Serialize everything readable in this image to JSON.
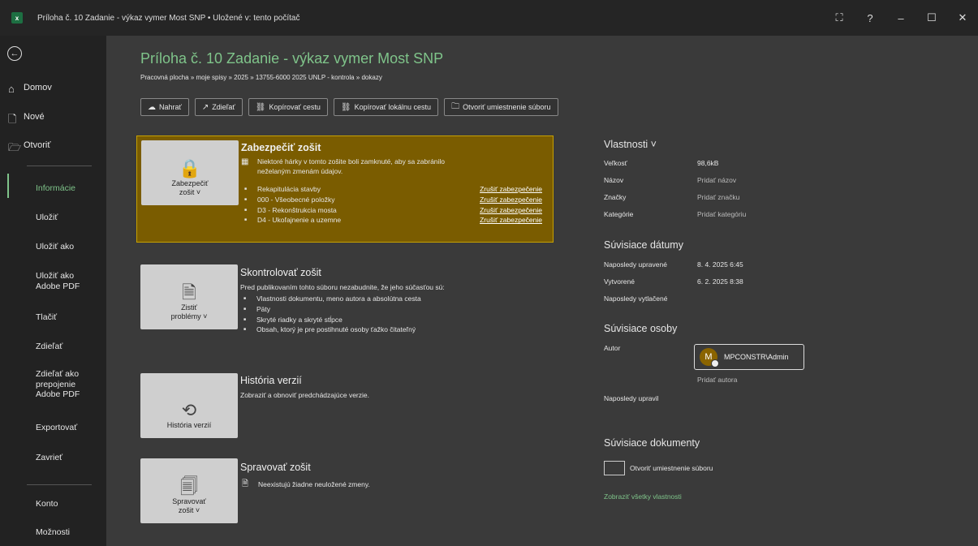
{
  "window": {
    "title": "Príloha č. 10 Zadanie - výkaz vymer Most SNP  •  Uložené v: tento počítač",
    "excel_glyph": "x",
    "ctrl_account": "⛶",
    "ctrl_help": "?",
    "ctrl_minimize": "–",
    "ctrl_maximize": "☐",
    "ctrl_close": "✕"
  },
  "sidebar": {
    "back_glyph": "←",
    "top": [
      {
        "label": "Domov",
        "icon": "home-icon"
      },
      {
        "label": "Nové",
        "icon": "new-document-icon"
      },
      {
        "label": "Otvoriť",
        "icon": "folder-open-icon"
      }
    ],
    "items": [
      {
        "label": "Informácie",
        "active": true
      },
      {
        "label": "Uložiť"
      },
      {
        "label": "Uložiť ako"
      },
      {
        "label": "Uložiť ako\nAdobe PDF"
      },
      {
        "label": "Tlačiť"
      },
      {
        "label": "Zdieľať"
      },
      {
        "label": "Zdieľať ako\nprepojenie\nAdobe PDF"
      },
      {
        "label": "Exportovať"
      },
      {
        "label": "Zavrieť"
      }
    ],
    "bottom": [
      {
        "label": "Konto"
      },
      {
        "label": "Možnosti"
      }
    ]
  },
  "header": {
    "title": "Príloha č. 10 Zadanie - výkaz vymer Most SNP",
    "breadcrumb": "Pracovná plocha » moje spisy » 2025 » 13755-6000 2025 UNLP - kontrola » dokazy"
  },
  "toolbar": [
    {
      "label": "Nahrať",
      "icon": "upload-icon"
    },
    {
      "label": "Zdieľať",
      "icon": "share-icon"
    },
    {
      "label": "Kopírovať cestu",
      "icon": "link-icon"
    },
    {
      "label": "Kopírovať lokálnu cestu",
      "icon": "link-icon"
    },
    {
      "label": "Otvoriť umiestnenie súboru",
      "icon": "folder-icon"
    }
  ],
  "protect": {
    "button": "Zabezpečiť\nzošit ˅",
    "title": "Zabezpečiť zošit",
    "desc": "Niektoré hárky v tomto zošite boli zamknuté, aby sa zabránilo\nneželaným zmenám údajov.",
    "sheets": [
      {
        "name": "Rekapitulácia stavby",
        "action": "Zrušiť zabezpečenie"
      },
      {
        "name": "000 - Všeobecné položky",
        "action": "Zrušiť zabezpečenie"
      },
      {
        "name": "D3 - Rekonštrukcia mosta",
        "action": "Zrušiť zabezpečenie"
      },
      {
        "name": "D4 - Ukoľajnenie a uzemne",
        "action": "Zrušiť zabezpečenie"
      }
    ]
  },
  "inspect": {
    "button": "Zistiť\nproblémy ˅",
    "title": "Skontrolovať zošit",
    "desc": "Pred publikovaním tohto súboru nezabudnite, že jeho súčasťou sú:",
    "items": [
      "Vlastnosti dokumentu, meno autora a absolútna cesta",
      "Päty",
      "Skryté riadky a skryté stĺpce",
      "Obsah, ktorý je pre postihnuté osoby ťažko čitateľný"
    ]
  },
  "versions": {
    "button": "História verzií",
    "title": "História verzií",
    "desc": "Zobraziť a obnoviť predchádzajúce verzie."
  },
  "manage": {
    "button": "Spravovať\nzošit ˅",
    "title": "Spravovať zošit",
    "desc": "Neexistujú žiadne neuložené zmeny."
  },
  "properties": {
    "heading": "Vlastnosti ˅",
    "rows": [
      {
        "label": "Veľkosť",
        "value": "98,6kB",
        "muted": false
      },
      {
        "label": "Názov",
        "value": "Pridať názov",
        "muted": true
      },
      {
        "label": "Značky",
        "value": "Pridať značku",
        "muted": true
      },
      {
        "label": "Kategórie",
        "value": "Pridať kategóriu",
        "muted": true
      }
    ],
    "dates_heading": "Súvisiace dátumy",
    "dates": [
      {
        "label": "Naposledy upravené",
        "value": "8. 4. 2025 6:45"
      },
      {
        "label": "Vytvorené",
        "value": "6. 2. 2025 8:38"
      },
      {
        "label": "Naposledy vytlačené",
        "value": ""
      }
    ],
    "people_heading": "Súvisiace osoby",
    "author_label": "Autor",
    "author_initial": "M",
    "author_name": "MPCONSTR\\Admin",
    "add_author": "Pridať autora",
    "last_modified_by": "Naposledy upravil",
    "docs_heading": "Súvisiace dokumenty",
    "open_location": "Otvoriť umiestnenie súboru",
    "show_all": "Zobraziť všetky vlastnosti"
  },
  "colors": {
    "accent": "#7fc48a",
    "warning_bg": "#7a5c00",
    "sidebar_bg": "#222222",
    "main_bg": "#3a3a3a"
  }
}
